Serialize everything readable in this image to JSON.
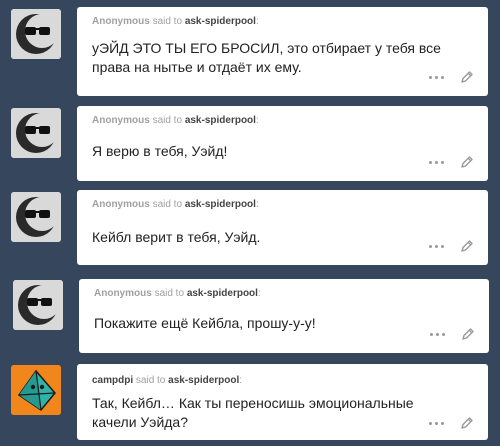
{
  "said_to_text": "said to",
  "recipient": "ask-spiderpool",
  "asks": [
    {
      "asker": "Anonymous",
      "avatar_icon": "anonymous-sunglasses-icon",
      "question": "уЭЙД ЭТО ТЫ ЕГО БРОСИЛ, это отбирает у тебя все права на нытье и отдаёт их ему."
    },
    {
      "asker": "Anonymous",
      "avatar_icon": "anonymous-sunglasses-icon",
      "question": "Я верю в тебя, Уэйд!"
    },
    {
      "asker": "Anonymous",
      "avatar_icon": "anonymous-sunglasses-icon",
      "question": "Кейбл верит в тебя, Уэйд."
    },
    {
      "asker": "Anonymous",
      "avatar_icon": "anonymous-sunglasses-icon",
      "question": "Покажите ещё Кейбла, прошу-у-у!"
    },
    {
      "asker": "campdpi",
      "avatar_icon": "campdpi-geometric-avatar-icon",
      "question": "Так, Кейбл… Как ты переносишь эмоциональные качели Уэйда?"
    }
  ],
  "colors": {
    "background": "#36465d",
    "card": "#ffffff",
    "campdpi_avatar_bg": "#f1861c",
    "campdpi_avatar_face": "#2fb3a8"
  }
}
